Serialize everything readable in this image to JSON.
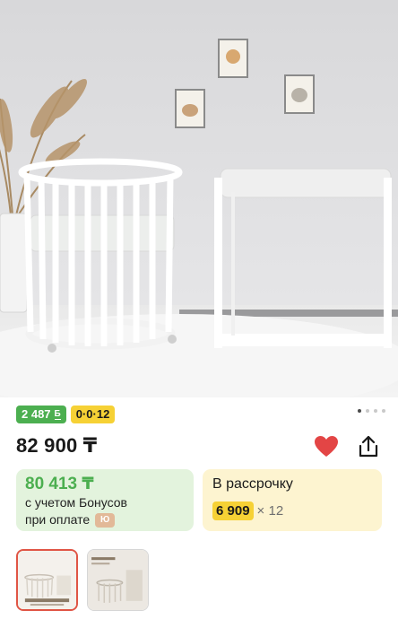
{
  "product": {
    "photo_alt": "",
    "price": "82 900 ₸",
    "badges": {
      "bonus_amount": "2 487",
      "bonus_icon": "Б",
      "installment_label": "0·0·12"
    },
    "gallery_dots": {
      "count": 4,
      "active_index": 0
    }
  },
  "bonus_card": {
    "amount": "80 413 ₸",
    "line1": "с учетом Бонусов",
    "line2": "при оплате",
    "pay_icon": "Ю"
  },
  "installment_card": {
    "title": "В рассрочку",
    "monthly": "6 909",
    "months": "× 12"
  },
  "thumbnails": [
    {
      "active": true,
      "caption": "КРОВАТКА-ТРАНСФОРМЕР"
    },
    {
      "active": false,
      "caption": "Кроватка-трансформер"
    }
  ],
  "colors": {
    "accent_green": "#4caf50",
    "accent_yellow": "#f6d135",
    "heart_red": "#e34545",
    "active_thumb_border": "#e05545"
  },
  "icons": [
    "heart-icon",
    "share-icon",
    "bonus-b-icon",
    "pay-logo-icon"
  ]
}
